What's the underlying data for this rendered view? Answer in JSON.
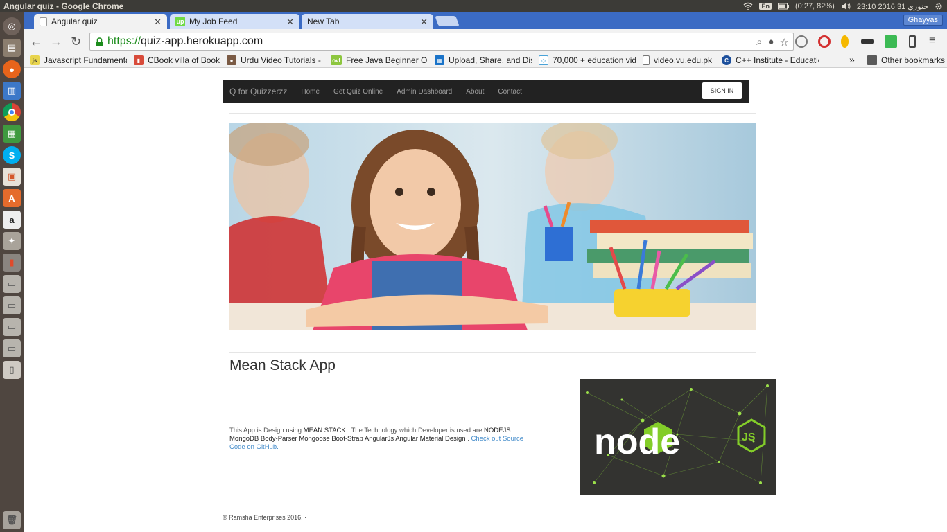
{
  "system": {
    "window_title": "Angular quiz - Google Chrome",
    "lang": "En",
    "battery": "(0:27, 82%)",
    "clock": "23:10 2016 31 جنوري"
  },
  "browser": {
    "tabs": [
      {
        "label": "Angular quiz",
        "active": true
      },
      {
        "label": "My Job Feed",
        "active": false
      },
      {
        "label": "New Tab",
        "active": false
      }
    ],
    "profile": "Ghayyas",
    "url_scheme": "https://",
    "url_rest": "quiz-app.herokuapp.com",
    "bookmarks": [
      "Javascript Fundamental",
      "CBook villa of Books",
      "Urdu Video Tutorials - C",
      "Free Java Beginner Onl",
      "Upload, Share, and Disc",
      "70,000 + education vide",
      "video.vu.edu.pk",
      "C++ Institute - Educatio"
    ],
    "bookmarks_overflow": "»",
    "other_bookmarks": "Other bookmarks"
  },
  "site": {
    "brand": "Q for Quizzerzz",
    "nav": [
      "Home",
      "Get Quiz Online",
      "Admin Dashboard",
      "About",
      "Contact"
    ],
    "signin": "SIGN IN",
    "section_title": "Mean Stack App",
    "desc_intro": "This App is Design using ",
    "desc_stack": "MEAN STACK",
    "desc_mid": " . The Technology which Developer is used are ",
    "desc_tech": "NODEJS MongoDB Body-Parser Mongoose Boot-Strap AngularJs Angular Material Design",
    "desc_sep": " . ",
    "desc_link": "Check out Source Code on GitHub.",
    "node_logo_text": "node",
    "node_js_badge": "JS",
    "footer": "© Ramsha Enterprises 2016. ·"
  },
  "colors": {
    "tabstrip": "#3b6bc4",
    "navbar": "#222222",
    "link": "#428bca"
  }
}
